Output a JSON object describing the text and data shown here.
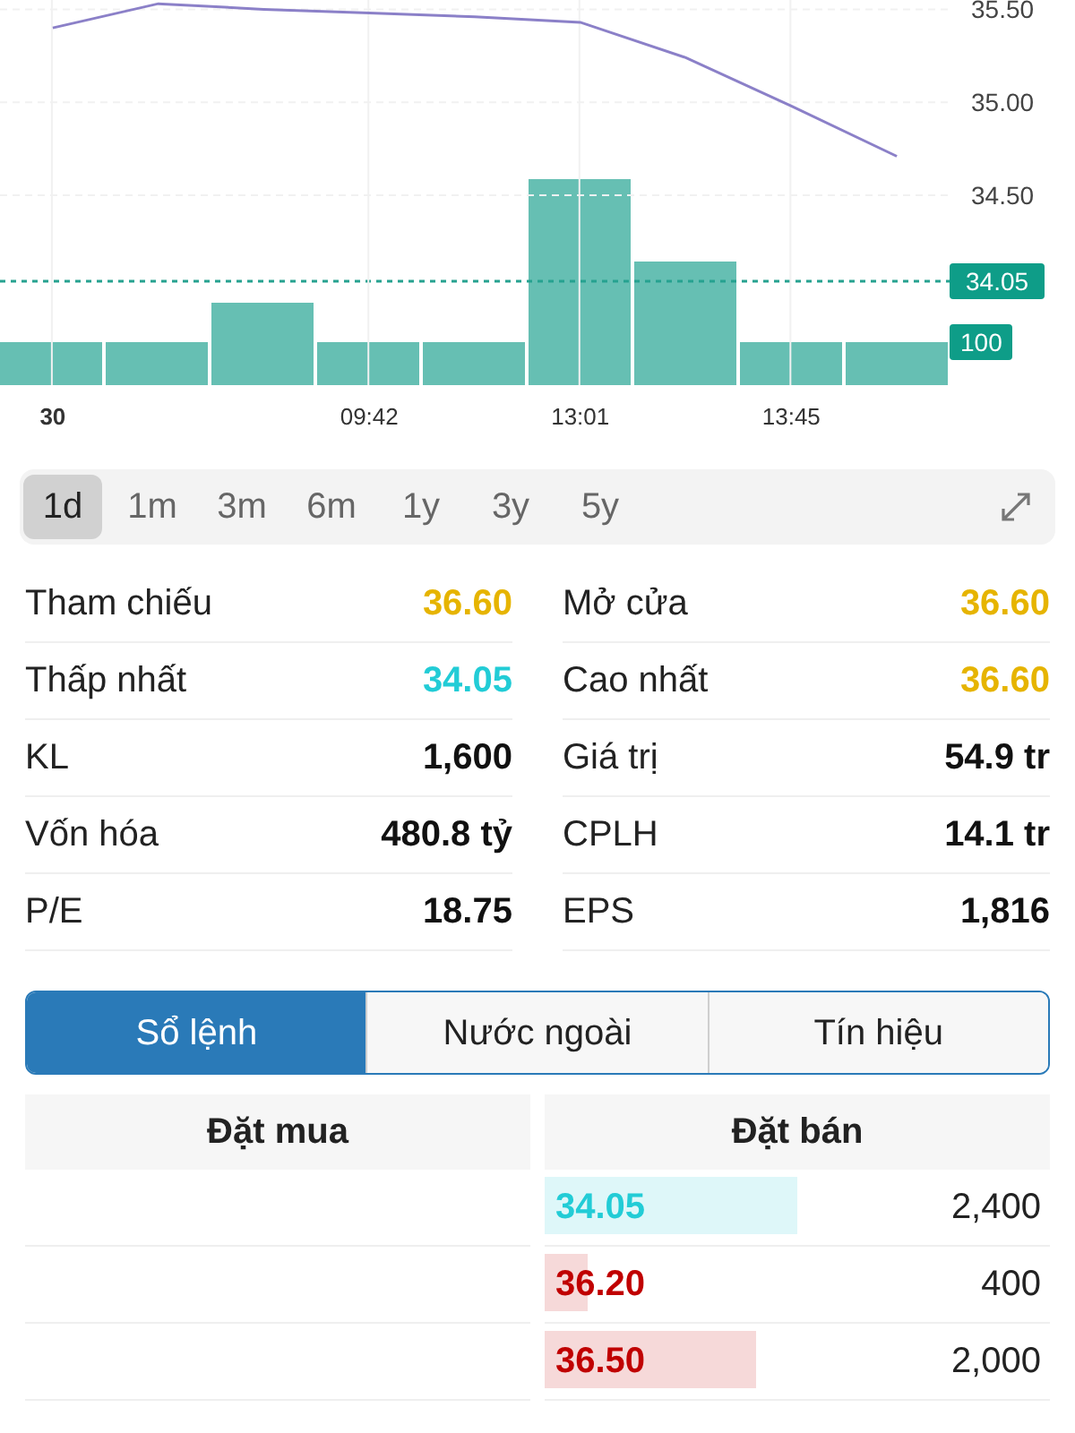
{
  "chart": {
    "chart_data": {
      "type": "line",
      "categories": [
        "30",
        null,
        null,
        "09:42",
        null,
        "13:01",
        null,
        "13:45",
        null
      ],
      "series": [
        {
          "color": "#8b80c8",
          "values": [
            35.4,
            35.53,
            35.5,
            35.48,
            35.46,
            35.43,
            35.24,
            34.98,
            34.71
          ]
        }
      ],
      "grid": true,
      "ylim": [
        33.48,
        35.55
      ],
      "yticks": [
        {
          "value": 35.5,
          "label": "35.50"
        },
        {
          "value": 35.0,
          "label": "35.00"
        },
        {
          "value": 34.5,
          "label": "34.50"
        }
      ]
    },
    "price_badge": "34.05",
    "volume_badge": "100"
  },
  "periods": [
    {
      "label": "1d",
      "selected": true
    },
    {
      "label": "1m",
      "selected": false
    },
    {
      "label": "3m",
      "selected": false
    },
    {
      "label": "6m",
      "selected": false
    },
    {
      "label": "1y",
      "selected": false
    },
    {
      "label": "3y",
      "selected": false
    },
    {
      "label": "5y",
      "selected": false
    }
  ],
  "stats": [
    {
      "label": "Tham chiếu",
      "value": "36.60",
      "color": "#e6b400"
    },
    {
      "label": "Mở cửa",
      "value": "36.60",
      "color": "#e6b400"
    },
    {
      "label": "Thấp nhất",
      "value": "34.05",
      "color": "#22ccd6"
    },
    {
      "label": "Cao nhất",
      "value": "36.60",
      "color": "#e6b400"
    },
    {
      "label": "KL",
      "value": "1,600",
      "color": "#111111"
    },
    {
      "label": "Giá trị",
      "value": "54.9 tr",
      "color": "#111111"
    },
    {
      "label": "Vốn hóa",
      "value": "480.8 tỷ",
      "color": "#111111"
    },
    {
      "label": "CPLH",
      "value": "14.1 tr",
      "color": "#111111"
    },
    {
      "label": "P/E",
      "value": "18.75",
      "color": "#111111"
    },
    {
      "label": "EPS",
      "value": "1,816",
      "color": "#111111"
    }
  ],
  "tabs": [
    {
      "label": "Sổ lệnh",
      "selected": true
    },
    {
      "label": "Nước ngoài",
      "selected": false
    },
    {
      "label": "Tín hiệu",
      "selected": false
    }
  ],
  "order_book": {
    "columns": [
      "Đặt mua",
      "Đặt bán"
    ],
    "asks": [
      {
        "price": "34.05",
        "volume": "2,400",
        "color": "#22ccd6",
        "level": 0.5
      },
      {
        "price": "36.20",
        "volume": "400",
        "color": "#c00000",
        "level": 0.085
      },
      {
        "price": "36.50",
        "volume": "2,000",
        "color": "#c00000",
        "level": 0.42
      }
    ]
  }
}
